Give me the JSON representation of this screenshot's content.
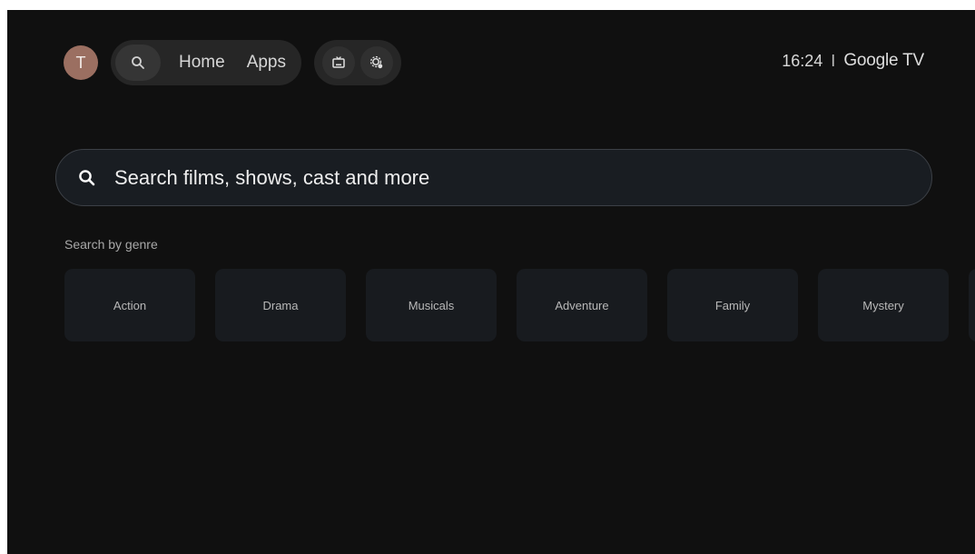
{
  "profile": {
    "initial": "T"
  },
  "nav": {
    "search_icon": "search-icon",
    "items": [
      {
        "label": "Home"
      },
      {
        "label": "Apps"
      }
    ],
    "actions": [
      {
        "icon": "inputs-icon"
      },
      {
        "icon": "settings-icon"
      }
    ]
  },
  "status": {
    "time": "16:24",
    "separator": "I",
    "brand": "Google TV"
  },
  "search": {
    "icon": "search-icon",
    "placeholder": "Search films, shows, cast and more"
  },
  "genres": {
    "title": "Search by genre",
    "items": [
      {
        "label": "Action"
      },
      {
        "label": "Drama"
      },
      {
        "label": "Musicals"
      },
      {
        "label": "Adventure"
      },
      {
        "label": "Family"
      },
      {
        "label": "Mystery"
      }
    ]
  },
  "colors": {
    "background": "#101010",
    "pill": "#262626",
    "avatar": "#9b6f61",
    "tile": "#181b1f"
  }
}
